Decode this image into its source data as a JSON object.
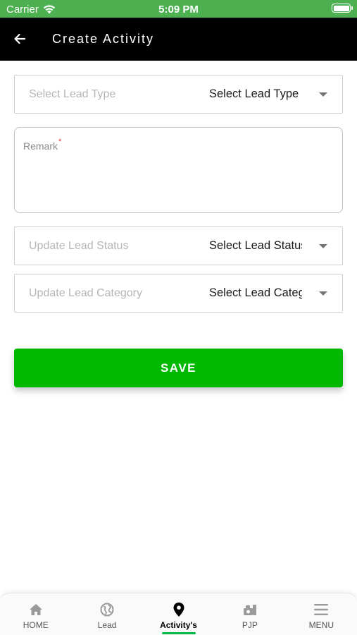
{
  "status_bar": {
    "carrier": "Carrier",
    "time": "5:09 PM"
  },
  "header": {
    "title": "Create Activity",
    "back_icon": "arrow-left-icon"
  },
  "form": {
    "lead_type": {
      "label": "Select Lead Type",
      "value": "Select Lead Type"
    },
    "remark": {
      "label": "Remark",
      "required_mark": "*"
    },
    "lead_status": {
      "label": "Update Lead Status",
      "value": "Select Lead Status"
    },
    "lead_category": {
      "label": "Update Lead Category",
      "value": "Select Lead Category"
    },
    "save_label": "SAVE"
  },
  "bottom_nav": {
    "items": [
      {
        "label": "HOME",
        "icon": "home-icon"
      },
      {
        "label": "Lead",
        "icon": "globe-icon"
      },
      {
        "label": "Activity's",
        "icon": "location-pin-icon",
        "active": true
      },
      {
        "label": "PJP",
        "icon": "pjp-icon"
      },
      {
        "label": "MENU",
        "icon": "menu-icon"
      }
    ]
  },
  "colors": {
    "status_bar": "#4caf50",
    "header": "#000000",
    "save_button": "#00b800",
    "active_indicator": "#00b84a",
    "required": "#e53935"
  }
}
